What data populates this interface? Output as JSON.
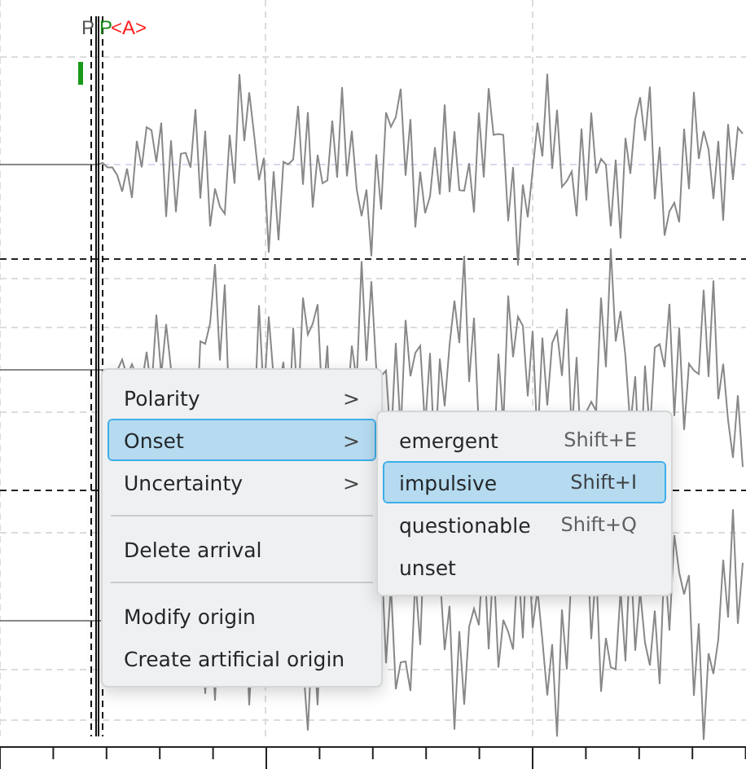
{
  "picks": [
    {
      "label": "P",
      "color": "#555555"
    },
    {
      "label": "P",
      "color": "#1a8a1a",
      "suffix": "<A>"
    }
  ],
  "context_menu": {
    "items": [
      {
        "kind": "submenu",
        "label": "Polarity",
        "arrow": ">",
        "selected": false
      },
      {
        "kind": "submenu",
        "label": "Onset",
        "arrow": ">",
        "selected": true
      },
      {
        "kind": "submenu",
        "label": "Uncertainty",
        "arrow": ">",
        "selected": false
      },
      {
        "kind": "separator"
      },
      {
        "kind": "action",
        "label": "Delete arrival",
        "selected": false
      },
      {
        "kind": "separator"
      },
      {
        "kind": "action",
        "label": "Modify origin",
        "selected": false
      },
      {
        "kind": "action",
        "label": "Create artificial origin",
        "selected": false
      }
    ]
  },
  "submenu": {
    "items": [
      {
        "label": "emergent",
        "shortcut": "Shift+E",
        "selected": false
      },
      {
        "label": "impulsive",
        "shortcut": "Shift+I",
        "selected": true
      },
      {
        "label": "questionable",
        "shortcut": "Shift+Q",
        "selected": false
      },
      {
        "label": "unset",
        "selected": false
      }
    ]
  }
}
